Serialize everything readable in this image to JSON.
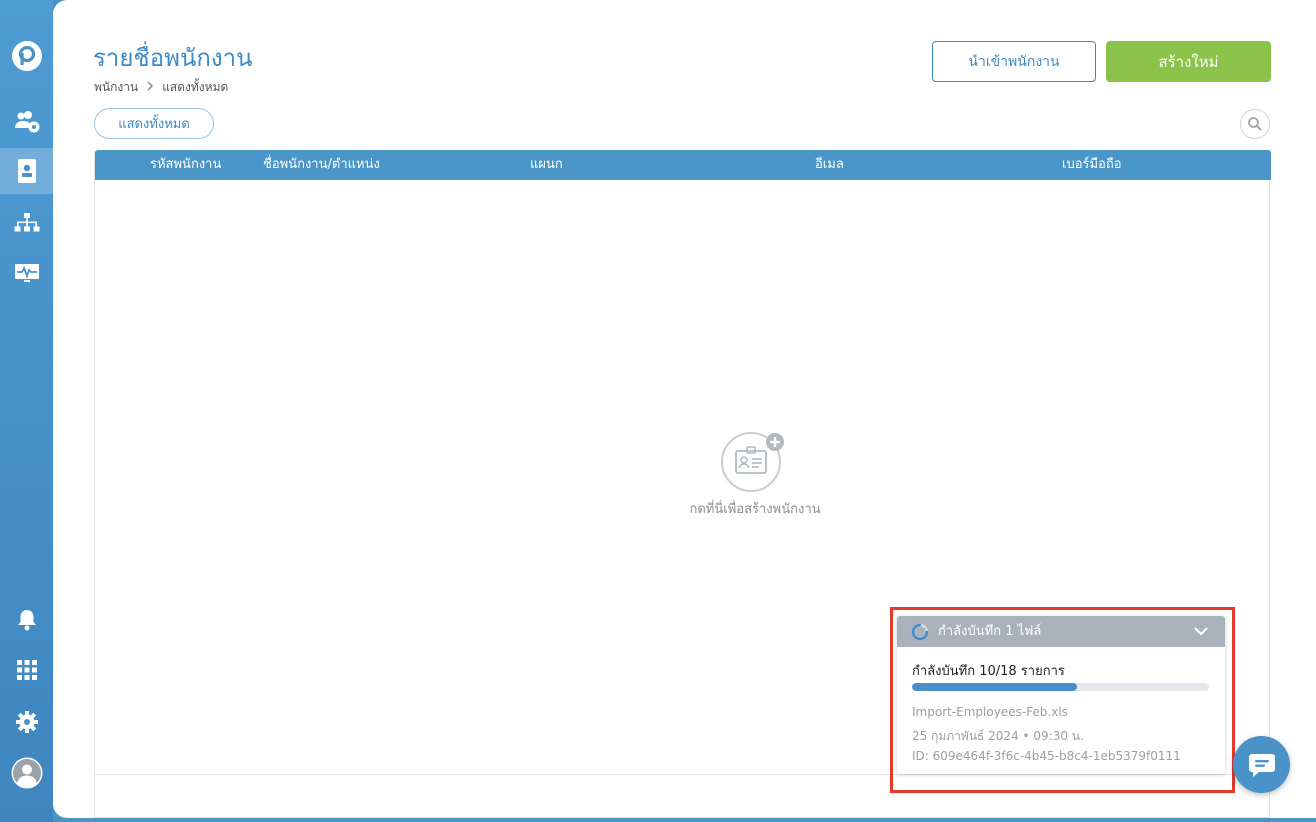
{
  "colors": {
    "sidebar": "#4a93c9",
    "primary": "#3d8ac4",
    "table_header": "#4a96c8",
    "create_button": "#8bc34a",
    "upload_header": "#a9b1bb",
    "progress": "#4a8fc7",
    "highlight": "#e23b2a"
  },
  "sidebar": {
    "items": [
      {
        "icon": "app-logo-icon"
      },
      {
        "icon": "user-settings-icon"
      },
      {
        "icon": "employee-card-icon",
        "active": true
      },
      {
        "icon": "org-chart-icon"
      },
      {
        "icon": "monitor-pulse-icon"
      },
      {
        "icon": "bell-icon"
      },
      {
        "icon": "apps-grid-icon"
      },
      {
        "icon": "gear-icon"
      },
      {
        "icon": "avatar-icon"
      }
    ]
  },
  "header": {
    "title": "รายชื่อพนักงาน",
    "breadcrumb": [
      "พนักงาน",
      "แสดงทั้งหมด"
    ],
    "import_label": "นำเข้าพนักงาน",
    "create_label": "สร้างใหม่"
  },
  "filter": {
    "chip_label": "แสดงทั้งหมด"
  },
  "table": {
    "columns": [
      "รหัสพนักงาน",
      "ชื่อพนักงาน/ตำแหน่ง",
      "แผนก",
      "อีเมล",
      "เบอร์มือถือ"
    ],
    "empty_text": "กดที่นี่เพื่อสร้างพนักงาน"
  },
  "upload": {
    "header_text": "กำลังบันทึก 1 ไฟล์",
    "status_text": "กำลังบันทึก 10/18 รายการ",
    "progress_done": 10,
    "progress_total": 18,
    "file_name": "Import-Employees-Feb.xls",
    "date_text": "25 กุมภาพันธ์ 2024 • 09:30 น.",
    "id_text": "ID: 609e464f-3f6c-4b45-b8c4-1eb5379f0111"
  }
}
